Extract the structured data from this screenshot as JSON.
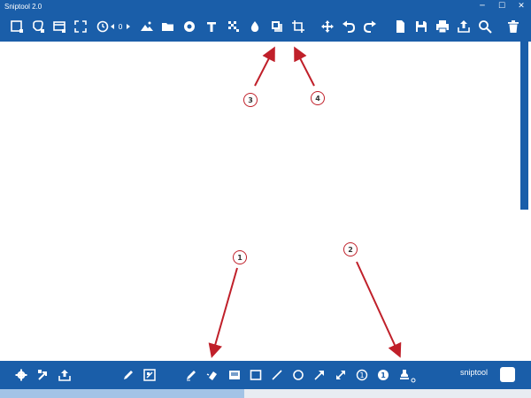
{
  "window": {
    "title": "Sniptool 2.0",
    "min_glyph": "─",
    "max_glyph": "☐",
    "close_glyph": "✕"
  },
  "colors": {
    "toolbar_blue": "#1a5ea9",
    "callout_red": "#c0202a",
    "background": "#ffffff"
  },
  "top_toolbar": {
    "icons": [
      "rect-select-icon",
      "freeform-select-icon",
      "window-select-icon",
      "fullscreen-select-icon",
      "timer-icon",
      "timer-value-icon",
      "image-icon",
      "folder-icon",
      "camera-icon",
      "text-icon",
      "crop-icon",
      "drop-icon",
      "shadow-icon",
      "border-icon",
      "move-icon",
      "undo-icon",
      "redo-icon",
      "copy-icon",
      "save-icon",
      "print-icon",
      "share-icon",
      "search-icon",
      "delete-icon"
    ],
    "timer_value": "0"
  },
  "bottom_toolbar": {
    "icons": [
      "settings-icon",
      "export-icon",
      "upload-icon",
      "pen-icon",
      "crop-tool-icon",
      "pencil-icon",
      "highlighter-icon",
      "blur-icon",
      "rectangle-icon",
      "line-icon",
      "ellipse-icon",
      "arrow-icon",
      "double-arrow-icon",
      "step-number-icon",
      "step-filled-icon",
      "stamp-icon"
    ],
    "brand": "sniptool"
  },
  "annotations": {
    "c1": "1",
    "c2": "2",
    "c3": "3",
    "c4": "4"
  },
  "status": {
    "progress": 0.46
  }
}
